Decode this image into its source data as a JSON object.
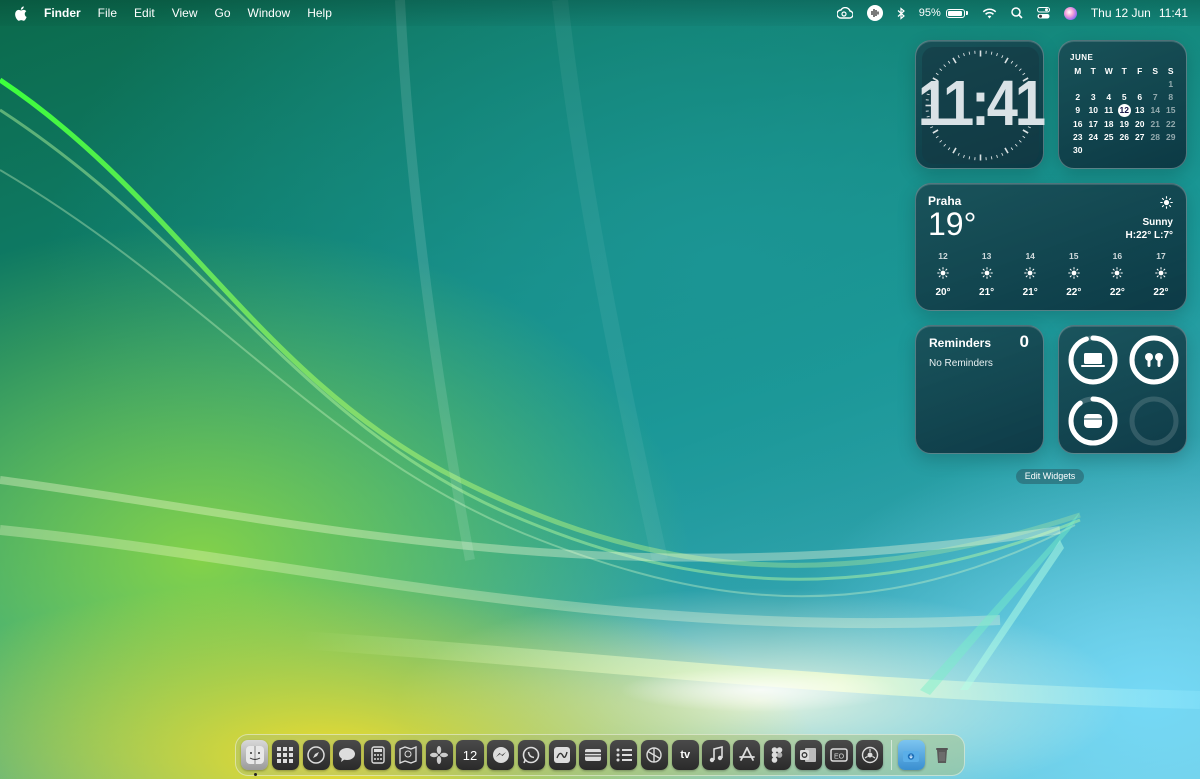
{
  "menubar": {
    "app_name": "Finder",
    "menus": [
      "File",
      "Edit",
      "View",
      "Go",
      "Window",
      "Help"
    ],
    "battery_percent": "95%",
    "battery_level": 0.95,
    "date": "Thu 12 Jun",
    "time": "11:41"
  },
  "widgets": {
    "clock": {
      "time": "11:41"
    },
    "calendar": {
      "month": "JUNE",
      "weekdays": [
        "M",
        "T",
        "W",
        "T",
        "F",
        "S",
        "S"
      ],
      "today": "12",
      "weeks": [
        [
          "",
          "",
          "",
          "",
          "",
          "",
          "1"
        ],
        [
          "2",
          "3",
          "4",
          "5",
          "6",
          "7",
          "8"
        ],
        [
          "9",
          "10",
          "11",
          "12",
          "13",
          "14",
          "15"
        ],
        [
          "16",
          "17",
          "18",
          "19",
          "20",
          "21",
          "22"
        ],
        [
          "23",
          "24",
          "25",
          "26",
          "27",
          "28",
          "29"
        ],
        [
          "30",
          "",
          "",
          "",
          "",
          "",
          ""
        ]
      ]
    },
    "weather": {
      "city": "Praha",
      "temperature": "19°",
      "condition": "Sunny",
      "high_low": "H:22° L:7°",
      "forecast": [
        {
          "day": "12",
          "temp": "20°",
          "icon": "sun-icon"
        },
        {
          "day": "13",
          "temp": "21°",
          "icon": "sun-icon"
        },
        {
          "day": "14",
          "temp": "21°",
          "icon": "sun-icon"
        },
        {
          "day": "15",
          "temp": "22°",
          "icon": "sun-icon"
        },
        {
          "day": "16",
          "temp": "22°",
          "icon": "sun-icon"
        },
        {
          "day": "17",
          "temp": "22°",
          "icon": "sun-icon"
        }
      ]
    },
    "reminders": {
      "title": "Reminders",
      "count": "0",
      "empty_text": "No Reminders"
    },
    "batteries": {
      "devices": [
        {
          "name": "laptop-icon",
          "level": 0.95
        },
        {
          "name": "airpods-icon",
          "level": 1.0
        },
        {
          "name": "airpods-case-icon",
          "level": 0.9
        },
        {
          "name": "empty-slot",
          "level": 0
        }
      ]
    },
    "edit_label": "Edit Widgets"
  },
  "dock": {
    "apps": [
      "finder-icon",
      "launchpad-icon",
      "safari-icon",
      "messages-icon",
      "calculator-icon",
      "maps-icon",
      "photos-icon",
      "calendar-icon",
      "messenger-icon",
      "whatsapp-icon",
      "freeform-icon",
      "wallet-icon",
      "reminders-icon",
      "chatgpt-icon",
      "tv-icon",
      "music-icon",
      "app-store-icon",
      "figma-icon",
      "outlook-icon",
      "pages-icon",
      "system-settings-icon"
    ],
    "calendar_date": "12",
    "tv_label": "tv",
    "stack": [
      "downloads-icon",
      "trash-icon"
    ]
  },
  "colors": {
    "widget_bg": "#0f3a46",
    "accent_green": "#4cd964",
    "wallpaper_green": "#2edb4a",
    "wallpaper_yellow": "#f5de28"
  }
}
